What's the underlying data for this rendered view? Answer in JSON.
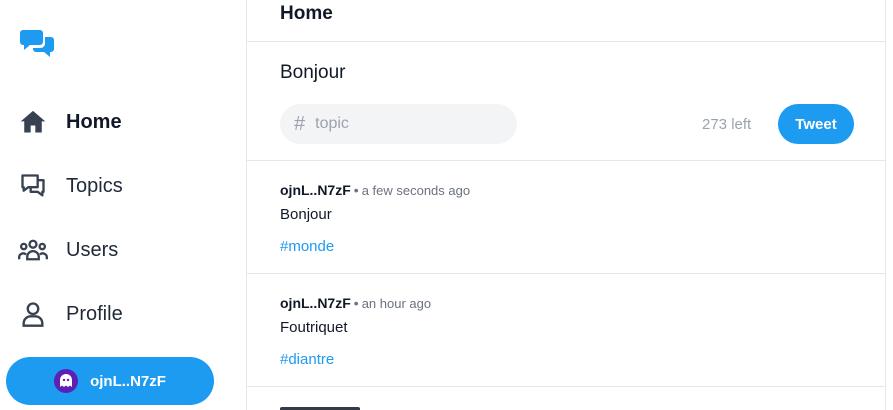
{
  "sidebar": {
    "logo_icon": "chat-bubbles-icon",
    "items": [
      {
        "label": "Home",
        "icon": "home-icon",
        "active": true
      },
      {
        "label": "Topics",
        "icon": "chat-bubble-icon",
        "active": false
      },
      {
        "label": "Users",
        "icon": "users-icon",
        "active": false
      },
      {
        "label": "Profile",
        "icon": "user-icon",
        "active": false
      }
    ],
    "user_button": {
      "label": "ojnL..N7zF",
      "avatar": "ghost-avatar-icon"
    }
  },
  "header": {
    "title": "Home"
  },
  "composer": {
    "text": "Bonjour",
    "topic_placeholder": "topic",
    "chars_left": "273 left",
    "tweet_label": "Tweet"
  },
  "posts": [
    {
      "author": "ojnL..N7zF",
      "separator": "•",
      "time": "a few seconds ago",
      "content": "Bonjour",
      "tag": "#monde"
    },
    {
      "author": "ojnL..N7zF",
      "separator": "•",
      "time": "an hour ago",
      "content": "Foutriquet",
      "tag": "#diantre"
    }
  ],
  "colors": {
    "accent": "#1d9bf0",
    "muted": "#9ca3af",
    "border": "#e5e7eb"
  }
}
